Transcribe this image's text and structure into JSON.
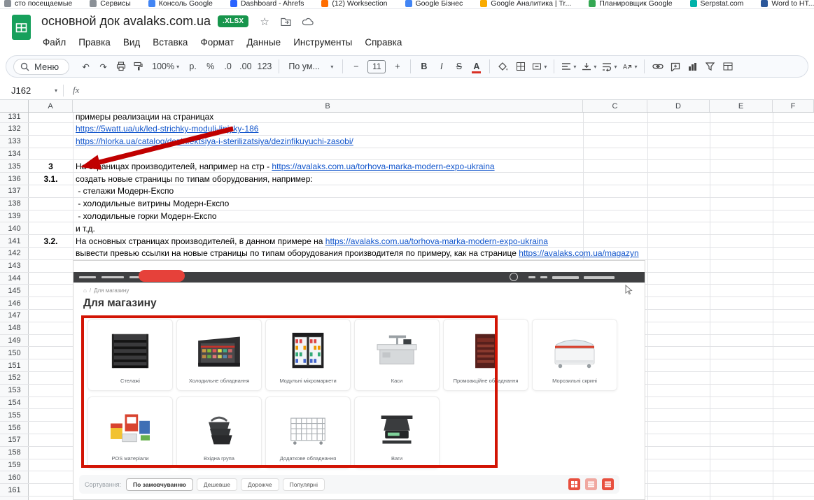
{
  "colors": {
    "sheets_green": "#17a05c",
    "badge_green": "#17954c",
    "link_blue": "#1155cc",
    "annotation_red": "#c00000",
    "highlight_red": "#d21404",
    "site_red": "#e6413a"
  },
  "bookmarks_bar": {
    "items": [
      {
        "label": "сто посещаемые",
        "color": "#8a9097"
      },
      {
        "label": "Сервисы",
        "color": "#8a9097"
      },
      {
        "label": "Консоль Google",
        "color": "#4285f4"
      },
      {
        "label": "Dashboard - Ahrefs",
        "color": "#2962ff"
      },
      {
        "label": "(12) Worksection",
        "color": "#ff6d00"
      },
      {
        "label": "Google Бізнес",
        "color": "#4285f4"
      },
      {
        "label": "Google Аналитика | Tr...",
        "color": "#f9ab00"
      },
      {
        "label": "Планировщик Google",
        "color": "#34a853"
      },
      {
        "label": "Serpstat.com",
        "color": "#00b2a9"
      },
      {
        "label": "Word to HT...",
        "color": "#2b579a"
      }
    ]
  },
  "header": {
    "title": "основной док avalaks.com.ua",
    "badge": ".XLSX",
    "menus": [
      "Файл",
      "Правка",
      "Вид",
      "Вставка",
      "Формат",
      "Данные",
      "Инструменты",
      "Справка"
    ]
  },
  "toolbar": {
    "search_label": "Меню",
    "zoom": "100%",
    "currency": "р.",
    "percent": "%",
    "decimal_decrease": ".0",
    "decimal_increase": ".00",
    "number_format": "123",
    "font_name": "По ум...",
    "decrease_font": "−",
    "font_size": "11",
    "increase_font": "+",
    "bold": "B",
    "italic": "I",
    "strikethrough": "S",
    "text_color": "A"
  },
  "formula_bar": {
    "cell_ref": "J162",
    "fx_label": "fx"
  },
  "grid": {
    "columns": [
      "A",
      "B",
      "C",
      "D",
      "E",
      "F"
    ],
    "first_row": 131,
    "last_row": 161,
    "cells": [
      {
        "row": 131,
        "b_text": "примеры реализации на страницах"
      },
      {
        "row": 132,
        "b_link": "https://5watt.ua/uk/led-strichky-moduli-linjyky-186"
      },
      {
        "row": 133,
        "b_link": "https://hlorka.ua/catalog/dezinfektsiya-i-sterilizatsiya/dezinfikuyuchi-zasobi/"
      },
      {
        "row": 135,
        "a": "3",
        "b_text": "На страницах производителей, например на стр - ",
        "b_link": "https://avalaks.com.ua/torhova-marka-modern-expo-ukraina"
      },
      {
        "row": 136,
        "a": "3.1.",
        "b_text": "создать новые страницы по типам оборудования, например:"
      },
      {
        "row": 137,
        "b_text": " - стелажи Модерн-Експо"
      },
      {
        "row": 138,
        "b_text": " - холодильные витрины Модерн-Експо"
      },
      {
        "row": 139,
        "b_text": " - холодильные горки Модерн-Експо"
      },
      {
        "row": 140,
        "b_text": "и т.д."
      },
      {
        "row": 141,
        "a": "3.2.",
        "b_text": "На основных страницах производителей, в данном примере на ",
        "b_link": "https://avalaks.com.ua/torhova-marka-modern-expo-ukraina"
      },
      {
        "row": 142,
        "b_text": "вывести превью ссылки на новые страницы по типам оборудования производителя по примеру, как на странице ",
        "b_link": "https://avalaks.com.ua/magazyn"
      }
    ]
  },
  "embedded_image": {
    "breadcrumb": "Для магазину",
    "heading": "Для магазину",
    "cards_row1": [
      {
        "label": "Стелажі",
        "icon": "shelving"
      },
      {
        "label": "Холодильне обладнання",
        "icon": "cooler"
      },
      {
        "label": "Модульні мікромаркети",
        "icon": "micromarket"
      },
      {
        "label": "Каси",
        "icon": "checkout"
      },
      {
        "label": "Промоакційне обладнання",
        "icon": "promo"
      },
      {
        "label": "Морозильні скрині",
        "icon": "freezer"
      }
    ],
    "cards_row2": [
      {
        "label": "POS матеріали",
        "icon": "pos"
      },
      {
        "label": "Вхідна група",
        "icon": "entrance"
      },
      {
        "label": "Додаткове обладнання",
        "icon": "extra"
      },
      {
        "label": "Ваги",
        "icon": "scales"
      }
    ],
    "sorting": {
      "label": "Сортування:",
      "options": [
        {
          "label": "По замовчуванню",
          "active": true
        },
        {
          "label": "Дешевше",
          "active": false
        },
        {
          "label": "Дорожче",
          "active": false
        },
        {
          "label": "Популярні",
          "active": false
        }
      ]
    }
  }
}
